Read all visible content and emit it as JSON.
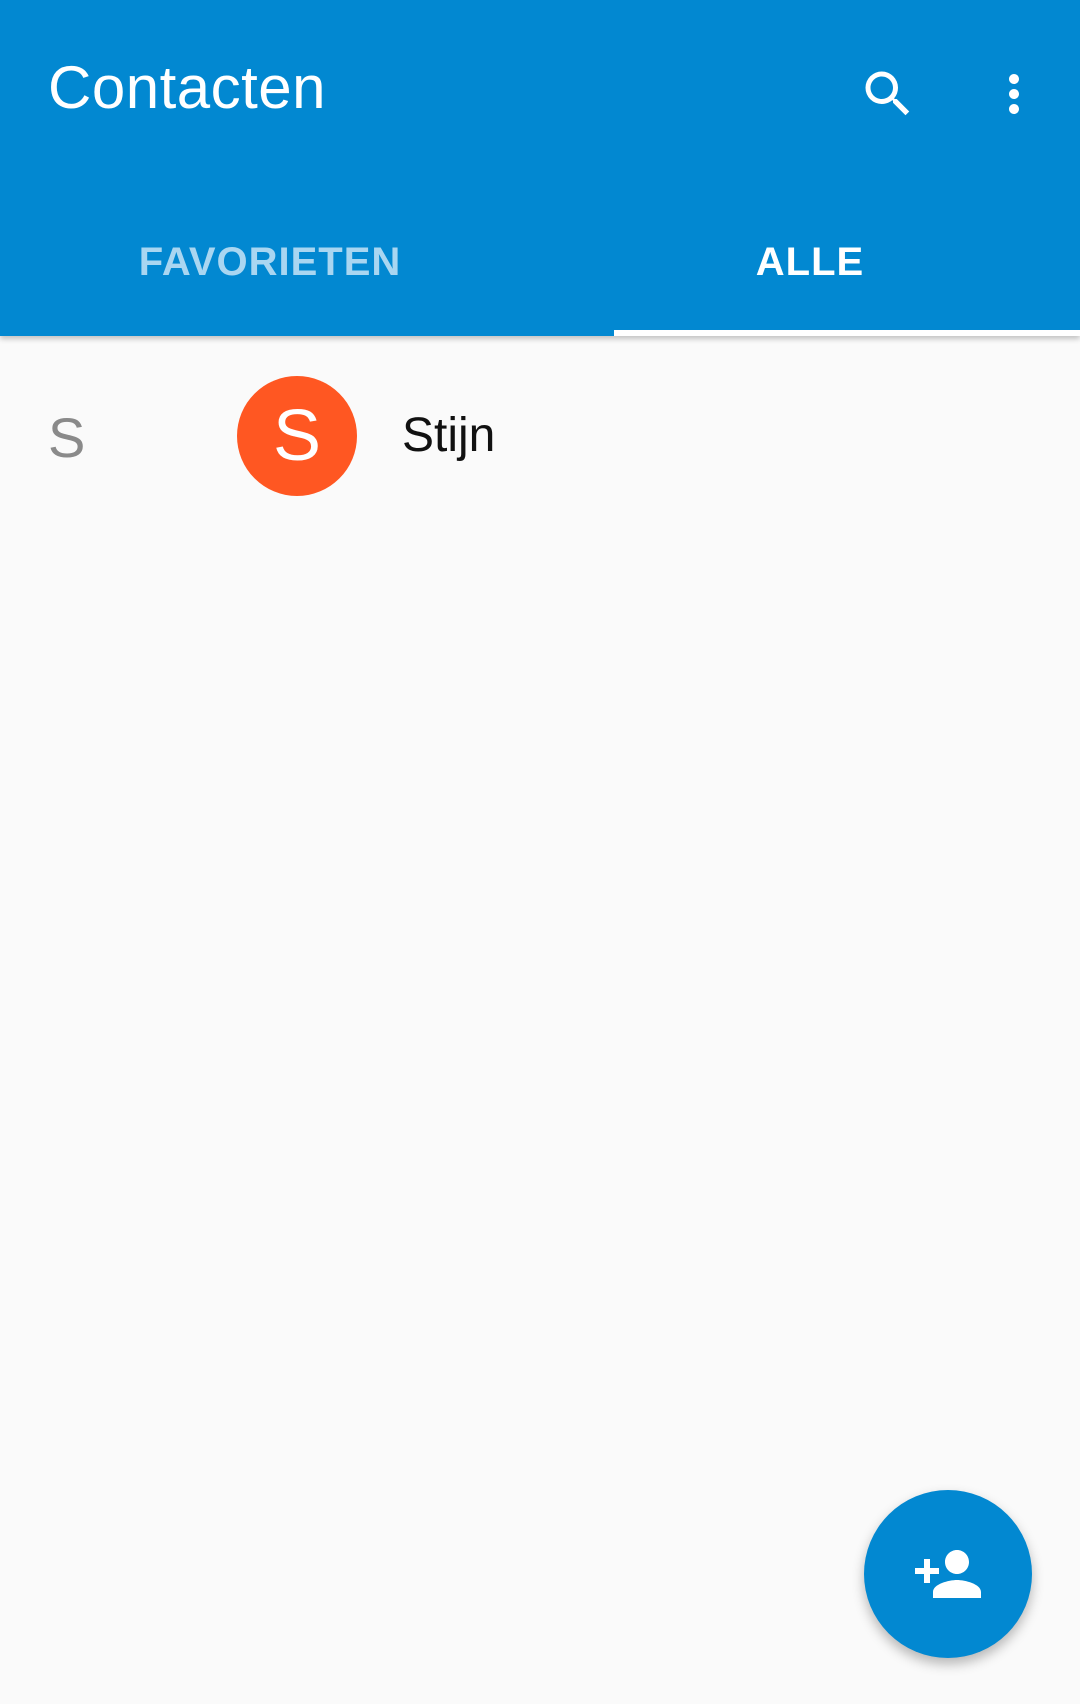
{
  "app": {
    "title": "Contacten",
    "accent_color": "#0288d1"
  },
  "toolbar": {
    "search_icon": "search-icon",
    "more_icon": "more-vert-icon"
  },
  "tabs": [
    {
      "label": "FAVORIETEN",
      "selected": false
    },
    {
      "label": "ALLE",
      "selected": true
    }
  ],
  "contacts": [
    {
      "section": "S",
      "initial": "S",
      "name": "Stijn",
      "avatar_color": "#ff5722"
    }
  ],
  "fab": {
    "icon": "add-person-icon"
  }
}
